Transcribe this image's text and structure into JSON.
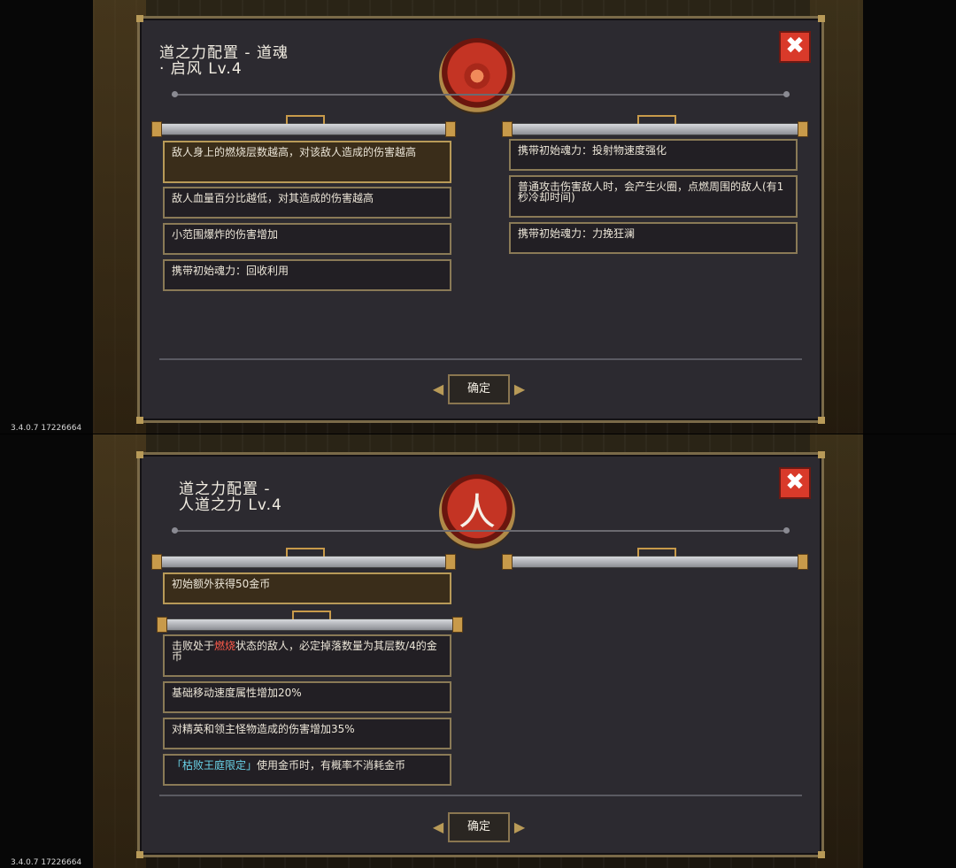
{
  "screens": [
    {
      "title": "道之力配置 - 道魂\n   · 启风 Lv.4",
      "close_label": "✖",
      "emblem_glyph": "",
      "left_effects": [
        "敌人身上的燃烧层数越高，对该敌人造成的伤害越高",
        "敌人血量百分比越低，对其造成的伤害越高",
        "小范围爆炸的伤害增加",
        "携带初始魂力：回收利用"
      ],
      "right_effects": [
        "携带初始魂力：投射物速度强化",
        "普通攻击伤害敌人时，会产生火圈，点燃周围的敌人(有1秒冷却时间)",
        "携带初始魂力：力挽狂澜"
      ],
      "confirm_label": "确定",
      "version": "3.4.0.7 17226664"
    },
    {
      "title": "道之力配置 -\n人道之力 Lv.4",
      "close_label": "✖",
      "emblem_glyph": "人",
      "top_effect": "初始额外获得50金币",
      "effect_1_pre": "击败处于",
      "effect_1_red": "燃烧",
      "effect_1_post": "状态的敌人，必定掉落数量为其层数/4的金币",
      "effect_2": "基础移动速度属性增加20%",
      "effect_3": "对精英和领主怪物造成的伤害增加35%",
      "effect_4_cyan": "「枯败王庭限定」",
      "effect_4_post": "使用金币时，有概率不消耗金币",
      "confirm_label": "确定",
      "version": "3.4.0.7 17226664"
    }
  ],
  "colors": {
    "panel": "#2c2a30",
    "border": "#7a6a48",
    "close": "#d93a2a",
    "accent_red": "#ff5a4a",
    "accent_cyan": "#6ad3e8"
  },
  "icons": [
    "close-icon",
    "fire-emblem-icon",
    "human-glyph-emblem-icon",
    "arrow-left-icon",
    "arrow-right-icon"
  ]
}
